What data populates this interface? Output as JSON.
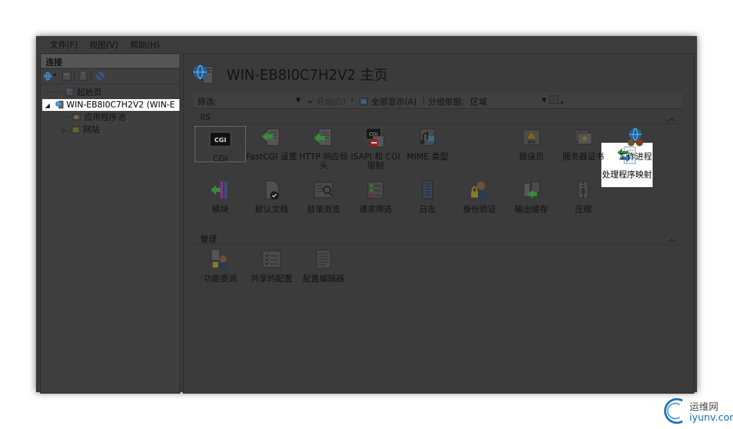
{
  "menu": {
    "file": "文件(F)",
    "view": "视图(V)",
    "help": "帮助(H)"
  },
  "connections": {
    "title": "连接",
    "tree": {
      "start_page": "起始页",
      "server": "WIN-EB8I0C7H2V2 (WIN-E",
      "app_pools": "应用程序池",
      "sites": "网站"
    }
  },
  "main": {
    "title": "WIN-EB8I0C7H2V2 主页",
    "filter": {
      "label": "筛选:",
      "go": "开始(G)",
      "show_all": "全部显示(A)",
      "group_by_label": "分组依据:",
      "group_by_value": "区域"
    },
    "groups": {
      "iis": {
        "name": "IIS",
        "features": [
          {
            "label": "CGI"
          },
          {
            "label": "FastCGI 设置"
          },
          {
            "label": "HTTP 响应标头"
          },
          {
            "label": "ISAPI 和 CGI 限制"
          },
          {
            "label": "MIME 类型"
          },
          {
            "label": "处理程序映射"
          },
          {
            "label": "错误页"
          },
          {
            "label": "服务器证书"
          },
          {
            "label": "工作进程"
          },
          {
            "label": "模块"
          },
          {
            "label": "默认文档"
          },
          {
            "label": "目录浏览"
          },
          {
            "label": "请求筛选"
          },
          {
            "label": "日志"
          },
          {
            "label": "身份验证"
          },
          {
            "label": "输出缓存"
          },
          {
            "label": "压缩"
          }
        ]
      },
      "management": {
        "name": "管理",
        "features": [
          {
            "label": "功能委派"
          },
          {
            "label": "共享的配置"
          },
          {
            "label": "配置编辑器"
          }
        ]
      }
    }
  },
  "watermark": {
    "name": "运维网",
    "url": "iyunv.com"
  }
}
